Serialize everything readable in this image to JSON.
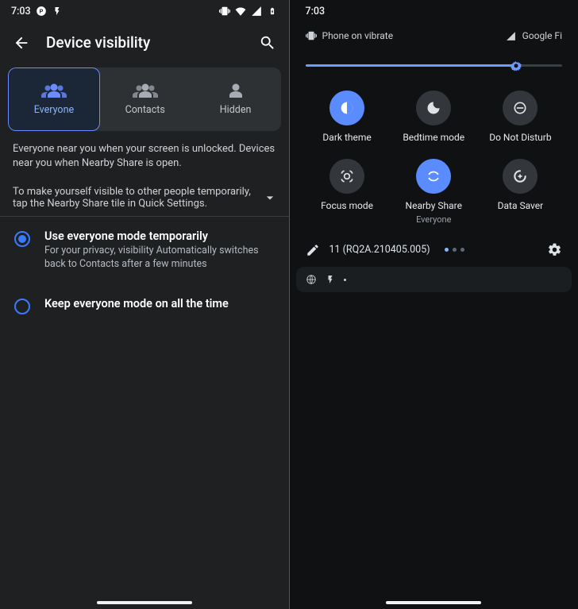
{
  "status": {
    "time": "7:03"
  },
  "left": {
    "title": "Device visibility",
    "tabs": {
      "everyone": "Everyone",
      "contacts": "Contacts",
      "hidden": "Hidden"
    },
    "desc1": "Everyone near you when your screen is unlocked. Devices near you when Nearby Share is open.",
    "desc2": "To make yourself visible to other people temporarily, tap the Nearby Share tile in Quick Settings.",
    "option1": {
      "title": "Use everyone mode temporarily",
      "sub": "For your privacy, visibility Automatically switches back to Contacts after a few minutes"
    },
    "option2": {
      "title": "Keep everyone mode on all the time"
    }
  },
  "right": {
    "vibrate": "Phone on vibrate",
    "carrier": "Google Fi",
    "brightness_pct": 82,
    "tiles": {
      "dark": "Dark theme",
      "bedtime": "Bedtime mode",
      "dnd": "Do Not Disturb",
      "focus": "Focus mode",
      "nearby": "Nearby Share",
      "nearby_sub": "Everyone",
      "datasaver": "Data Saver"
    },
    "build": "11 (RQ2A.210405.005)"
  }
}
